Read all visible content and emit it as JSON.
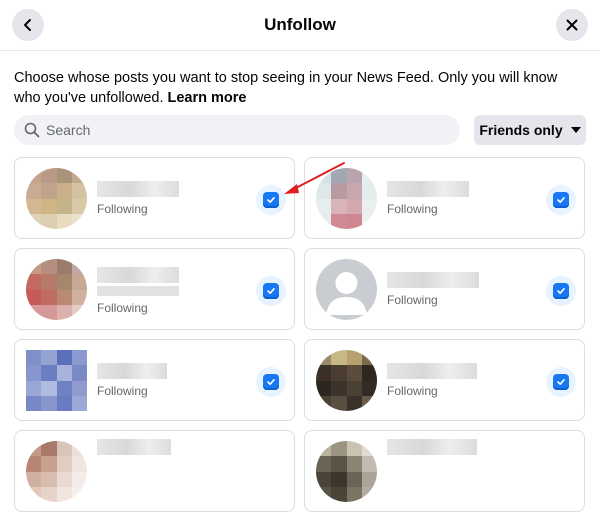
{
  "dialog": {
    "title": "Unfollow",
    "description": "Choose whose posts you want to stop seeing in your News Feed. Only you will know who you've unfollowed.",
    "learn_more": "Learn more"
  },
  "search": {
    "placeholder": "Search"
  },
  "filter": {
    "label": "Friends only"
  },
  "cards": [
    {
      "status": "Following",
      "checked": true
    },
    {
      "status": "Following",
      "checked": true
    },
    {
      "status": "Following",
      "checked": true
    },
    {
      "status": "Following",
      "checked": true
    },
    {
      "status": "Following",
      "checked": true
    },
    {
      "status": "Following",
      "checked": true
    },
    {
      "status": "",
      "checked": false
    },
    {
      "status": "",
      "checked": false
    }
  ],
  "colors": {
    "accent": "#1877f2",
    "annotation_arrow": "#e02020"
  }
}
